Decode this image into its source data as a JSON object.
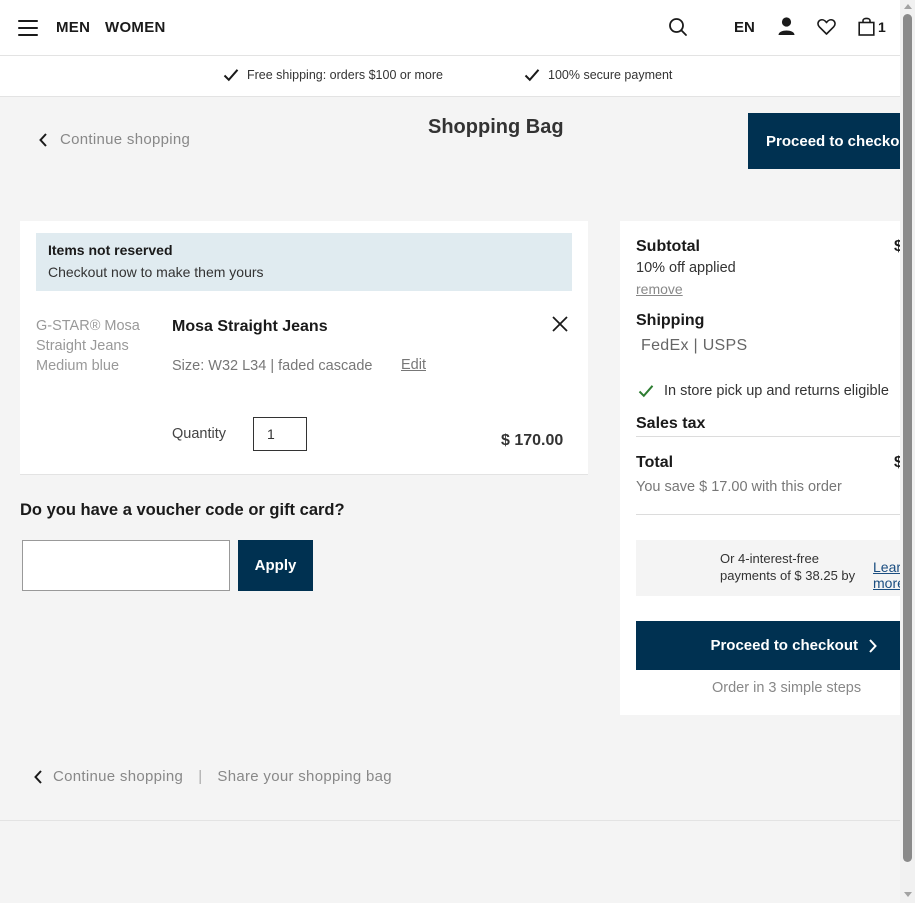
{
  "header": {
    "nav": [
      "MEN",
      "WOMEN"
    ],
    "language": "EN",
    "cart_count": "1",
    "icons": [
      "menu-icon",
      "search-icon",
      "account-icon",
      "wishlist-icon",
      "bag-icon"
    ]
  },
  "usp": {
    "shipping": "Free shipping: orders $100 or more",
    "payment": "100% secure payment"
  },
  "top": {
    "continue_label": "Continue shopping",
    "title": "Shopping Bag",
    "checkout_label": "Proceed to checkout"
  },
  "notice": {
    "title": "Items not reserved",
    "text": "Checkout now to make them yours"
  },
  "product": {
    "image_alt": "G-STAR® Mosa Straight Jeans Medium blue",
    "name": "Mosa Straight Jeans",
    "size": "Size: W32 L34 | faded cascade",
    "edit_label": "Edit",
    "quantity_label": "Quantity",
    "quantity_value": "1",
    "price": "$ 170.00"
  },
  "voucher": {
    "title": "Do you have a voucher code or gift card?",
    "apply_label": "Apply"
  },
  "summary": {
    "subtotal_label": "Subtotal",
    "subtotal_value": "$",
    "discount_text": "10% off applied",
    "remove_label": "remove",
    "shipping_label": "Shipping",
    "carriers": "FedEx | USPS",
    "pickup_text": "In store pick up and returns eligible",
    "tax_label": "Sales tax",
    "total_label": "Total",
    "total_value": "$",
    "save_text": "You save $ 17.00 with this order",
    "afterpay_text": "Or 4-interest-free payments of $ 38.25 by",
    "afterpay_learn": "Learn more",
    "checkout_label": "Proceed to checkout",
    "steps_text": "Order in 3 simple steps"
  },
  "bottom": {
    "continue_label": "Continue shopping",
    "separator": "|",
    "share_label": "Share your shopping bag"
  },
  "colors": {
    "primary": "#003151",
    "notice_bg": "#e0ebf0",
    "check_green": "#2e7d32"
  }
}
